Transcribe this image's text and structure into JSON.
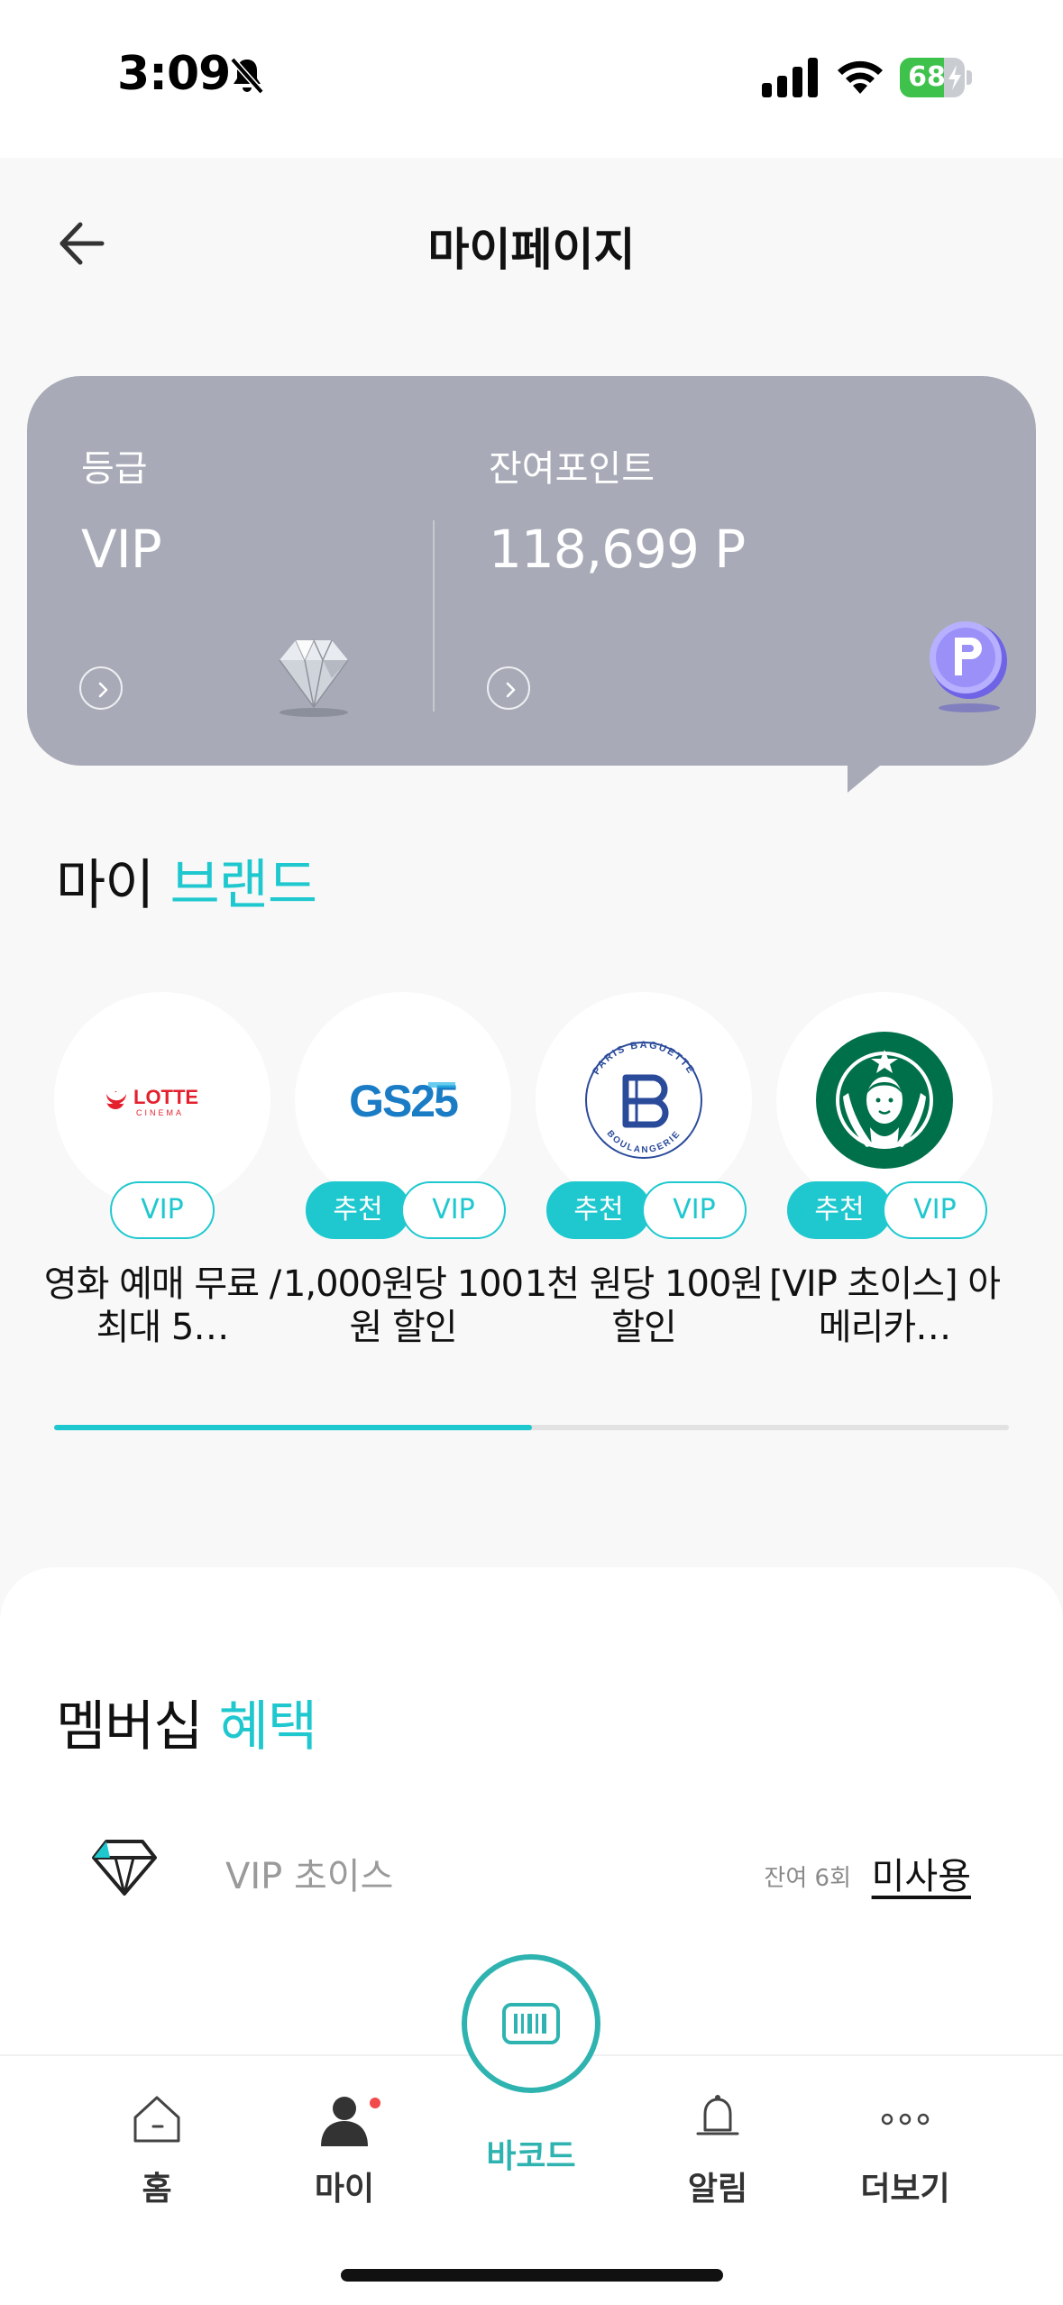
{
  "status_bar": {
    "time": "3:09",
    "battery": "68",
    "battery_level": 0.68,
    "icons": [
      "bell-slash-icon",
      "signal-icon",
      "wifi-icon",
      "battery-icon"
    ]
  },
  "header": {
    "title": "마이페이지",
    "back_icon": "arrow-left-icon"
  },
  "grade_card": {
    "grade_label": "등급",
    "grade_value": "VIP",
    "points_label": "잔여포인트",
    "points_value": "118,699 P",
    "background": "#a8abb7"
  },
  "my_brands": {
    "title_prefix": "마이",
    "title_accent": "브랜드",
    "items": [
      {
        "logo": "lotte-cinema-logo",
        "logo_text": "LOTTE",
        "logo_subtext": "CINEMA",
        "badges": [
          "VIP"
        ],
        "description": "영화 예매 무료 / 최대 5…"
      },
      {
        "logo": "gs25-logo",
        "logo_text": "GS25",
        "badges": [
          "추천",
          "VIP"
        ],
        "description": "1,000원당 100원 할인"
      },
      {
        "logo": "paris-baguette-logo",
        "logo_text": "PARIS BAGUETTE",
        "logo_subtext": "BOULANGERIE",
        "badges": [
          "추천",
          "VIP"
        ],
        "description": "1천 원당 100원 할인"
      },
      {
        "logo": "starbucks-logo",
        "badges": [
          "추천",
          "VIP"
        ],
        "description": "[VIP 초이스] 아메리카…"
      }
    ],
    "scroll_progress": 0.5
  },
  "membership": {
    "title_prefix": "멤버십",
    "title_accent": "혜택",
    "benefits": [
      {
        "icon": "diamond-outline-icon",
        "name": "VIP 초이스",
        "remaining": "잔여 6회",
        "status": "미사용"
      }
    ]
  },
  "bottom_nav": {
    "items": [
      {
        "icon": "home-icon",
        "label": "홈"
      },
      {
        "icon": "person-icon",
        "label": "마이",
        "has_dot": true
      },
      {
        "icon": "bell-icon",
        "label": "알림"
      },
      {
        "icon": "more-dots-icon",
        "label": "더보기"
      }
    ],
    "center": {
      "icon": "barcode-icon",
      "label": "바코드"
    }
  },
  "colors": {
    "accent": "#1fc8cf",
    "barcode_accent": "#2fb3b0",
    "notification_dot": "#f2494a"
  }
}
